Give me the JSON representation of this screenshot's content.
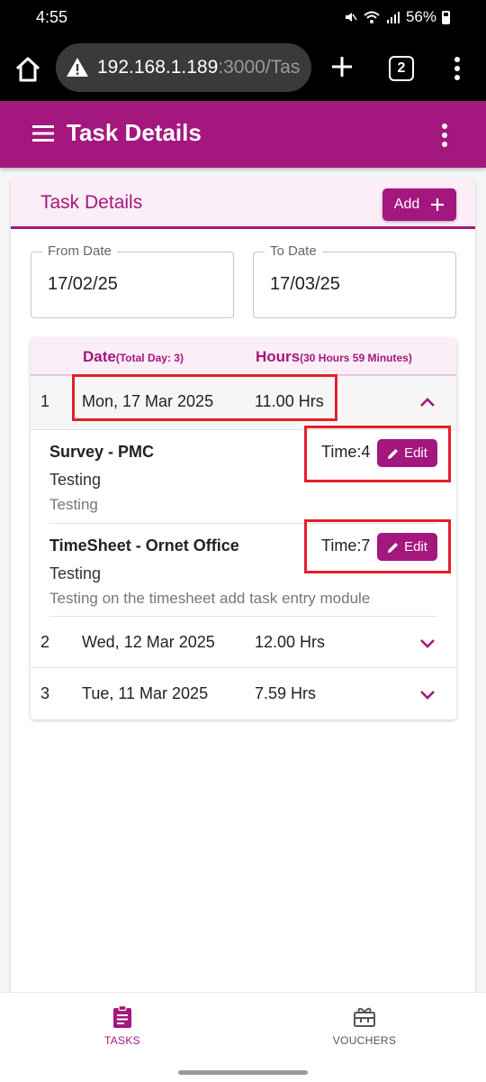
{
  "status_bar": {
    "time": "4:55",
    "battery": "56%"
  },
  "browser": {
    "url_host": "192.168.1.189",
    "url_path": ":3000/Tas",
    "tab_count": "2"
  },
  "app_bar": {
    "title": "Task Details"
  },
  "card": {
    "title": "Task Details",
    "add_label": "Add",
    "from_date": {
      "label": "From Date",
      "value": "17/02/25"
    },
    "to_date": {
      "label": "To Date",
      "value": "17/03/25"
    }
  },
  "table": {
    "date_header": "Date",
    "date_sub": "(Total Day: 3)",
    "hours_header": "Hours",
    "hours_sub": "(30 Hours 59 Minutes)",
    "rows": [
      {
        "num": "1",
        "date": "Mon, 17 Mar 2025",
        "hours": "11.00 Hrs",
        "expanded": true,
        "tasks": [
          {
            "name": "Survey - PMC",
            "desc": "Testing",
            "note": "Testing",
            "time": "Time:4",
            "edit": "Edit"
          },
          {
            "name": "TimeSheet - Ornet Office",
            "desc": "Testing",
            "note": "Testing on the timesheet add task entry module",
            "time": "Time:7",
            "edit": "Edit"
          }
        ]
      },
      {
        "num": "2",
        "date": "Wed, 12 Mar 2025",
        "hours": "12.00 Hrs",
        "expanded": false
      },
      {
        "num": "3",
        "date": "Tue, 11 Mar 2025",
        "hours": "7.59 Hrs",
        "expanded": false
      }
    ]
  },
  "bottom_nav": {
    "tasks_label": "TASKS",
    "vouchers_label": "VOUCHERS",
    "active": "tasks"
  },
  "colors": {
    "primary": "#a3177e",
    "primary_light": "#fbeef7",
    "highlight": "#e3202a"
  }
}
